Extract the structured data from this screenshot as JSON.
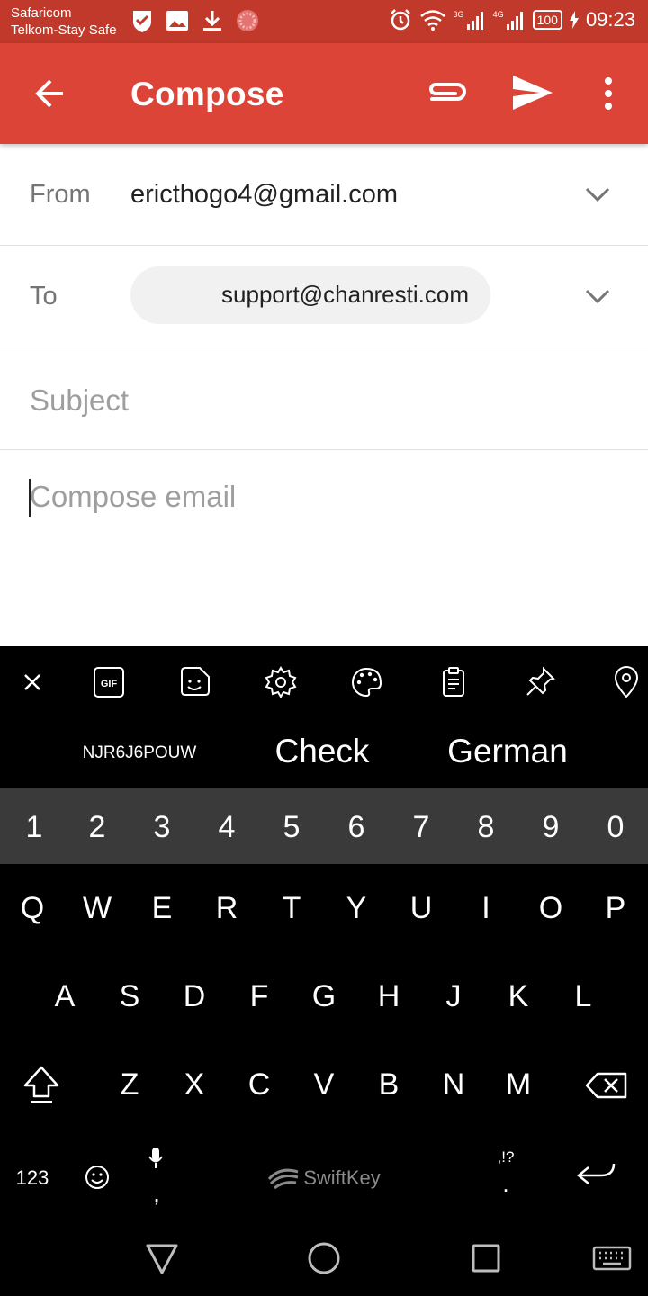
{
  "status_bar": {
    "carrier_1": "Safaricom",
    "carrier_2": "Telkom-Stay Safe",
    "net1": "3G",
    "net2": "4G",
    "battery": "100",
    "time": "09:23"
  },
  "app_bar": {
    "title": "Compose",
    "color": "#db4437"
  },
  "form": {
    "from_label": "From",
    "from_value": "ericthogo4@gmail.com",
    "to_label": "To",
    "to_chip": "support@chanresti.com",
    "subject_placeholder": "Subject",
    "body_placeholder": "Compose email"
  },
  "keyboard": {
    "suggestions": [
      "NJR6J6POUW",
      "Check",
      "German"
    ],
    "number_row": [
      "1",
      "2",
      "3",
      "4",
      "5",
      "6",
      "7",
      "8",
      "9",
      "0"
    ],
    "row1": [
      "Q",
      "W",
      "E",
      "R",
      "T",
      "Y",
      "U",
      "I",
      "O",
      "P"
    ],
    "row2": [
      "A",
      "S",
      "D",
      "F",
      "G",
      "H",
      "J",
      "K",
      "L"
    ],
    "row3": [
      "Z",
      "X",
      "C",
      "V",
      "B",
      "N",
      "M"
    ],
    "numbers_key": "123",
    "comma_key": ",",
    "punct_key_top": ",!?",
    "period_key": ".",
    "brand": "SwiftKey"
  }
}
